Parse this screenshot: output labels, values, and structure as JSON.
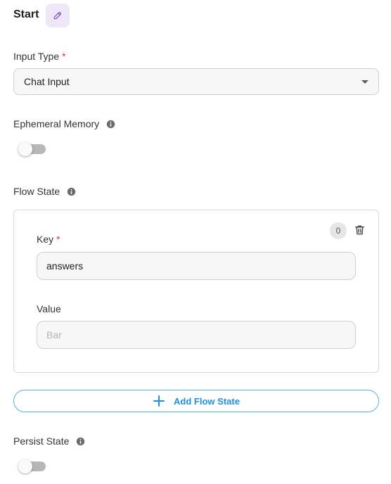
{
  "header": {
    "title": "Start"
  },
  "input_type": {
    "label": "Input Type",
    "required_mark": "*",
    "value": "Chat Input"
  },
  "ephemeral_memory": {
    "label": "Ephemeral Memory",
    "enabled": false
  },
  "flow_state": {
    "label": "Flow State",
    "items": [
      {
        "index": "0",
        "key_label": "Key",
        "key_required": "*",
        "key_value": "answers",
        "value_label": "Value",
        "value_placeholder": "Bar"
      }
    ],
    "add_label": "Add Flow State"
  },
  "persist_state": {
    "label": "Persist State",
    "enabled": false
  },
  "colors": {
    "accent_blue": "#1f8ee6",
    "edit_purple": "#7b4bc4",
    "required_red": "#e53935"
  }
}
